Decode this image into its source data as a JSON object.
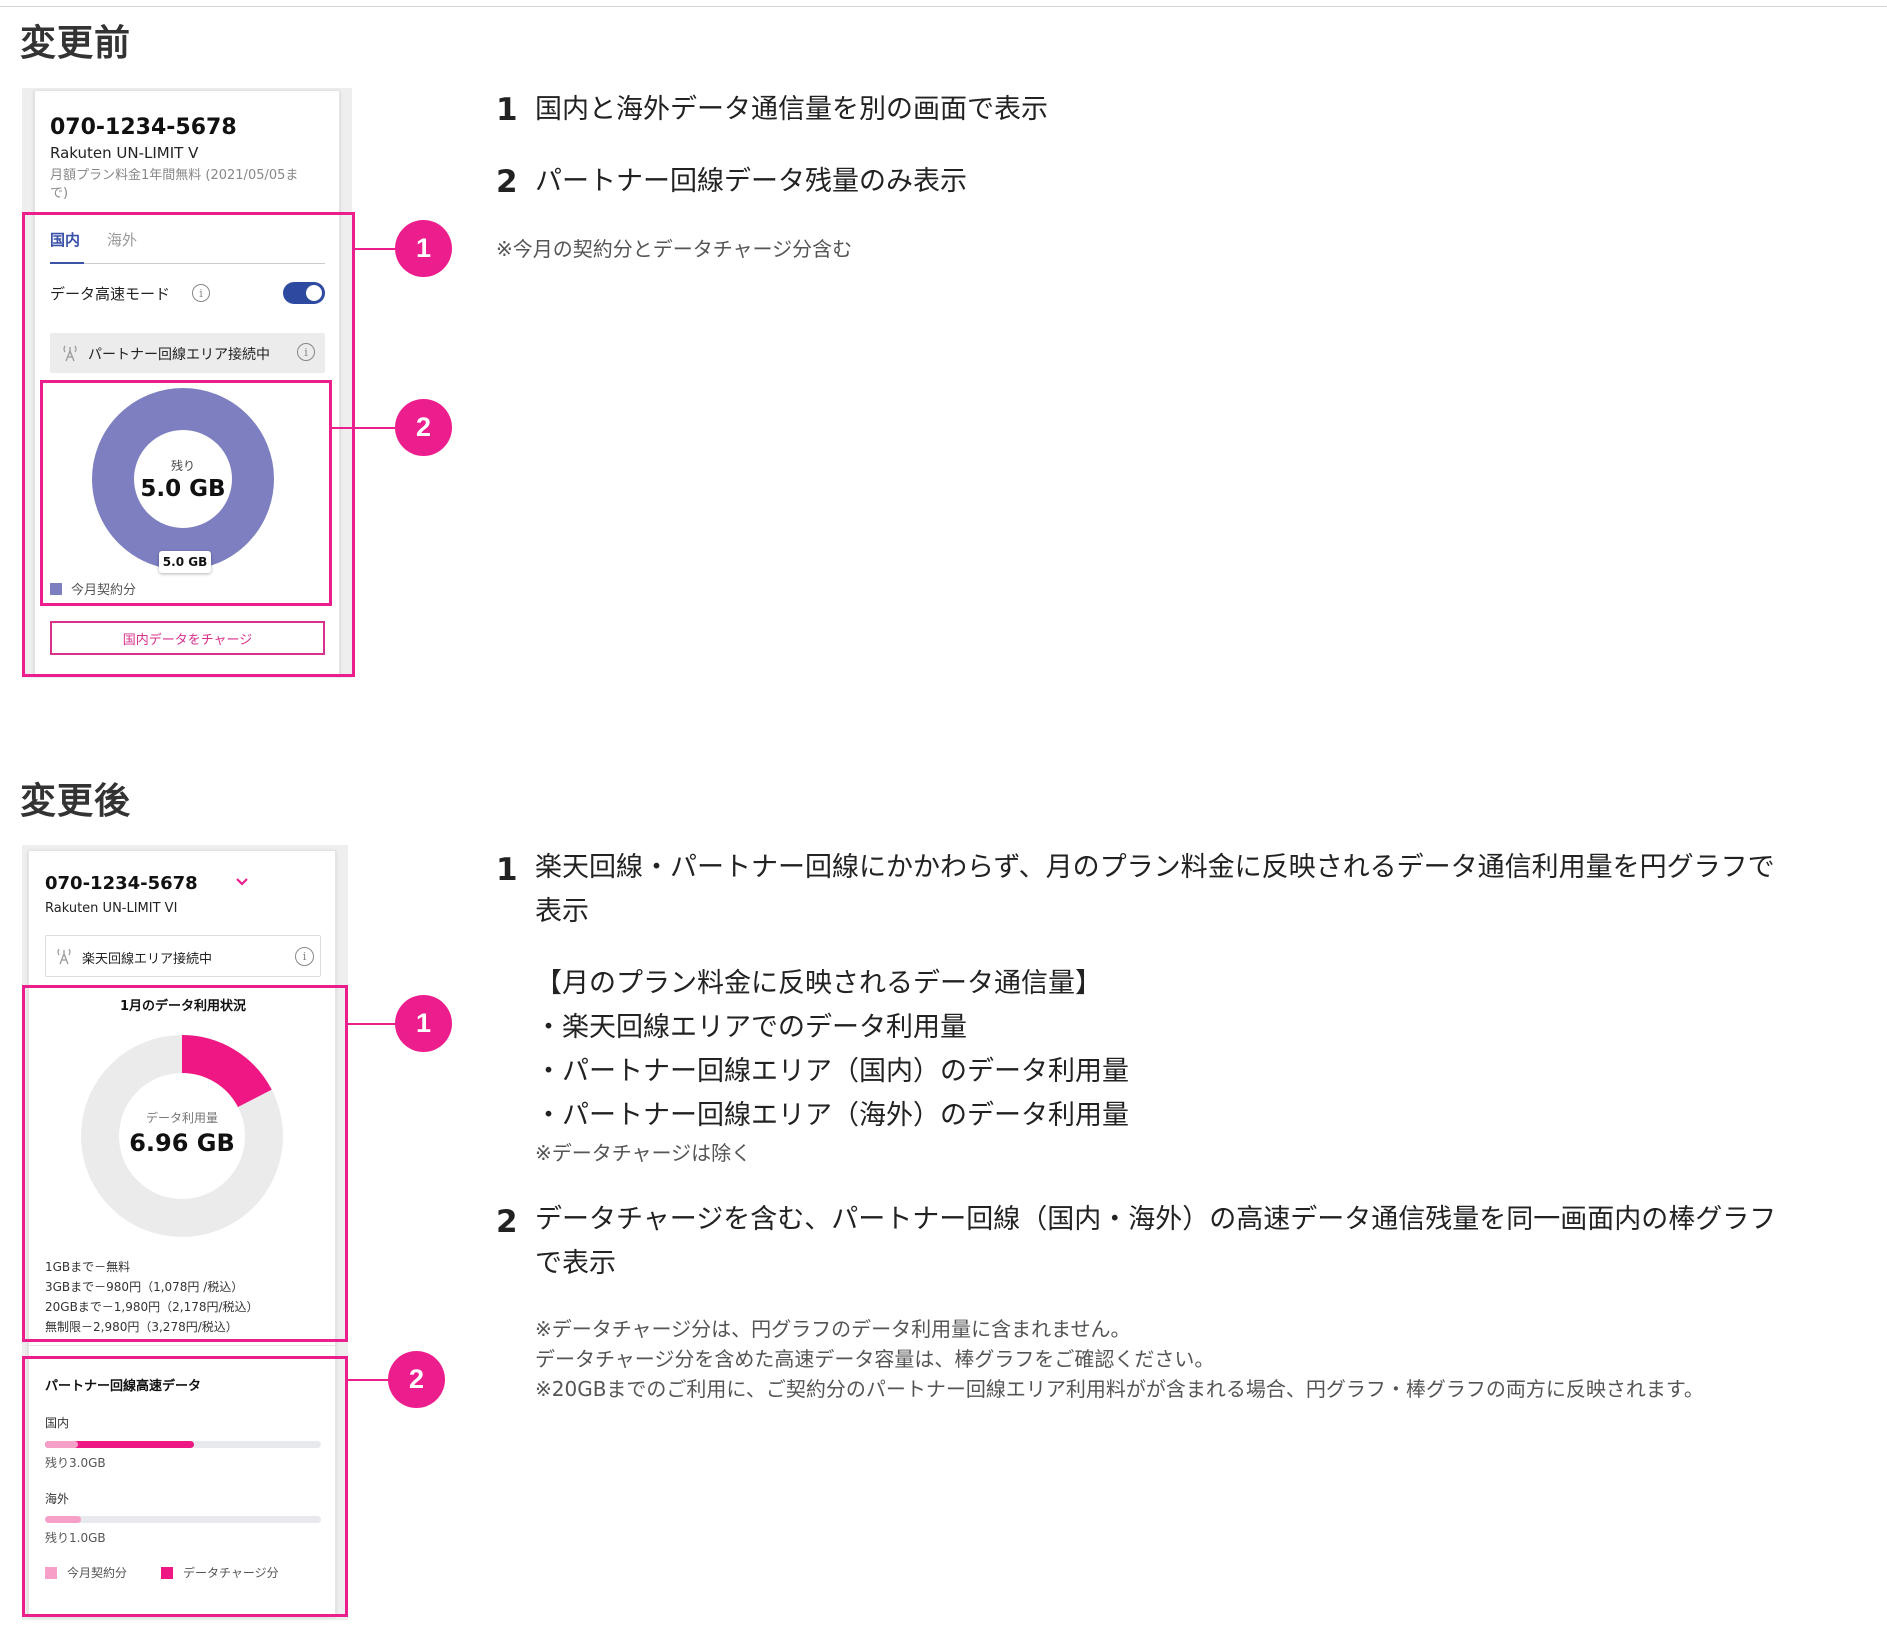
{
  "colors": {
    "accent": "#ec1e8e",
    "navy": "#3a52a8",
    "donut_purple": "#7d7fc1",
    "pink_light": "#f6a0c8",
    "pink_dark": "#ef1783",
    "donut_grey": "#ebebeb"
  },
  "before": {
    "title": "変更前",
    "phone": {
      "number": "070-1234-5678",
      "plan": "Rakuten UN-LIMIT V",
      "plan_note_line1": "月額プラン料金1年間無料 (2021/05/05ま",
      "plan_note_line2": "で)",
      "tabs": [
        {
          "label": "国内",
          "active": true
        },
        {
          "label": "海外",
          "active": false
        }
      ],
      "mode_label": "データ高速モード",
      "mode_on": true,
      "area_status": "パートナー回線エリア接続中",
      "donut": {
        "center_label": "残り",
        "center_value": "5.0 GB",
        "tag_value": "5.0 GB",
        "remaining_fraction": 1.0
      },
      "legend": "今月契約分",
      "charge_button": "国内データをチャージ"
    },
    "callouts": [
      "1",
      "2"
    ],
    "points": [
      {
        "num": "1",
        "text": "国内と海外データ通信量を別の画面で表示"
      },
      {
        "num": "2",
        "text": "パートナー回線データ残量のみ表示"
      }
    ],
    "note": "※今月の契約分とデータチャージ分含む"
  },
  "after": {
    "title": "変更後",
    "phone": {
      "number": "070-1234-5678",
      "plan": "Rakuten UN-LIMIT VI",
      "area_status": "楽天回線エリア接続中",
      "usage_title": "1月のデータ利用状況",
      "donut": {
        "center_label": "データ利用量",
        "center_value": "6.96 GB",
        "used_fraction": 0.174
      },
      "tiers": [
        "1GBまで－無料",
        "3GBまで－980円（1,078円 /税込）",
        "20GBまで－1,980円（2,178円/税込）",
        "無制限－2,980円（3,278円/税込）"
      ],
      "partner_title": "パートナー回線高速データ",
      "bars": [
        {
          "label": "国内",
          "remaining": "残り3.0GB",
          "contract_fraction": 0.12,
          "charge_fraction": 0.54
        },
        {
          "label": "海外",
          "remaining": "残り1.0GB",
          "contract_fraction": 0.13,
          "charge_fraction": 0.0
        }
      ],
      "legend_contract": "今月契約分",
      "legend_charge": "データチャージ分"
    },
    "callouts": [
      "1",
      "2"
    ],
    "point1": {
      "num": "1",
      "text_line1": "楽天回線・パートナー回線にかかわらず、月のプラン料金に反映されるデータ通信利用量を円グラフで",
      "text_line2": "表示",
      "list_heading": "【月のプラン料金に反映されるデータ通信量】",
      "list": [
        "・楽天回線エリアでのデータ利用量",
        "・パートナー回線エリア（国内）のデータ利用量",
        "・パートナー回線エリア（海外）のデータ利用量"
      ],
      "note": "※データチャージは除く"
    },
    "point2": {
      "num": "2",
      "text_line1": "データチャージを含む、パートナー回線（国内・海外）の高速データ通信残量を同一画面内の棒グラフ",
      "text_line2": "で表示",
      "notes": [
        "※データチャージ分は、円グラフのデータ利用量に含まれません。",
        "データチャージ分を含めた高速データ容量は、棒グラフをご確認ください。",
        "※20GBまでのご利用に、ご契約分のパートナー回線エリア利用料がが含まれる場合、円グラフ・棒グラフの両方に反映されます。"
      ]
    }
  }
}
